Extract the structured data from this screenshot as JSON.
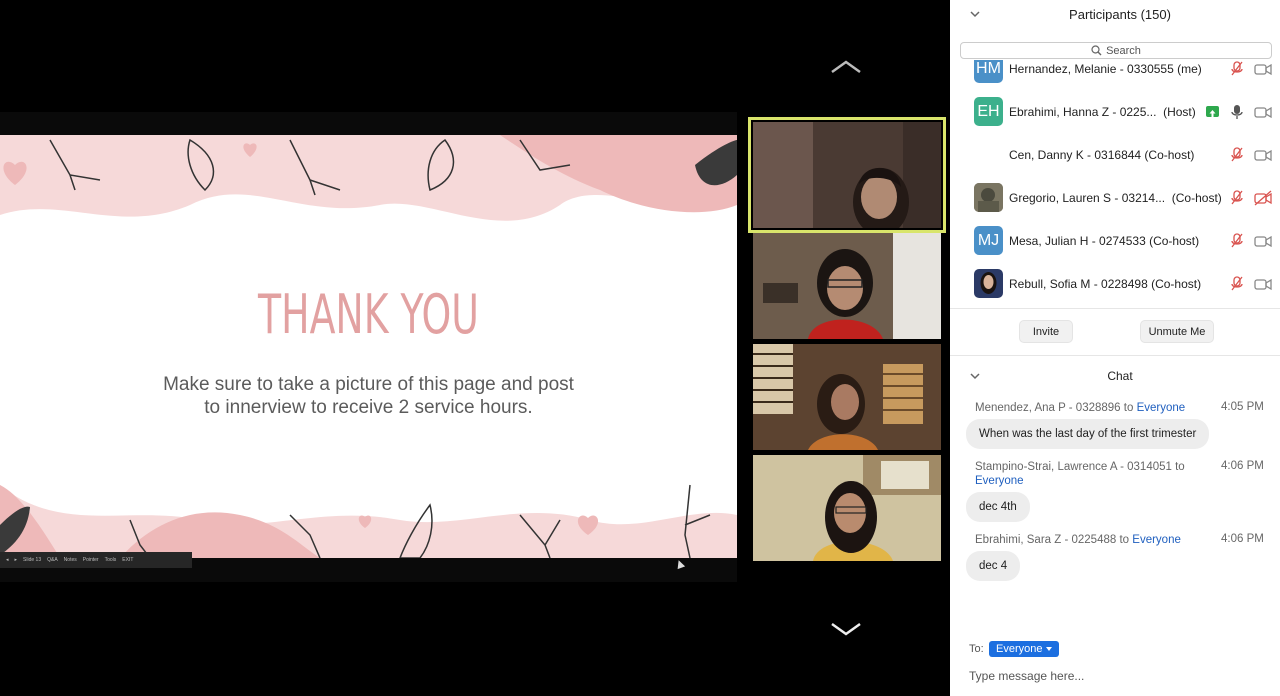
{
  "slide": {
    "title": "Thank you",
    "body_line1": "Make sure to take a picture of this page and post",
    "body_line2": "to innerview to receive 2 service hours.",
    "toolbar": [
      "Slide 13",
      "Q&A",
      "Notes",
      "Pointer",
      "Tools",
      "EXIT"
    ]
  },
  "participants": {
    "title": "Participants (150)",
    "search_placeholder": "Search",
    "rows": [
      {
        "initials": "HM",
        "name": "Hernandez, Melanie - 0330555 (me)",
        "color": "#4a90c8",
        "mic": "muted",
        "cam": "on"
      },
      {
        "initials": "EH",
        "name": "Ebrahimi, Hanna Z - 0225...",
        "role": "(Host)",
        "color": "#3cb08c",
        "mic": "on",
        "cam": "on",
        "sharing": true
      },
      {
        "initials": "",
        "name": "Cen, Danny K - 0316844 (Co-host)",
        "color": "",
        "mic": "muted",
        "cam": "on"
      },
      {
        "initials": "",
        "name": "Gregorio, Lauren S - 03214...",
        "role": "(Co-host)",
        "color": "#6e6a5a",
        "mic": "muted",
        "cam": "off",
        "photo": true
      },
      {
        "initials": "MJ",
        "name": "Mesa, Julian H - 0274533 (Co-host)",
        "color": "#4a90c8",
        "mic": "muted",
        "cam": "on"
      },
      {
        "initials": "",
        "name": "Rebull, Sofia M - 0228498 (Co-host)",
        "color": "#2b3a66",
        "mic": "muted",
        "cam": "on",
        "photo": true
      }
    ],
    "invite_label": "Invite",
    "unmute_label": "Unmute Me"
  },
  "chat": {
    "title": "Chat",
    "messages": [
      {
        "sender": "Menendez, Ana P - 0328896",
        "to": "to",
        "recipient": "Everyone",
        "time": "4:05 PM",
        "text": "When was the last day of the first trimester"
      },
      {
        "sender": "Stampino-Strai, Lawrence A - 0314051",
        "to": "to",
        "recipient": "Everyone",
        "time": "4:06 PM",
        "text": "dec 4th"
      },
      {
        "sender": "Ebrahimi, Sara Z - 0225488",
        "to": "to",
        "recipient": "Everyone",
        "time": "4:06 PM",
        "text": "dec 4"
      }
    ],
    "to_label": "To:",
    "to_value": "Everyone",
    "input_placeholder": "Type message here..."
  },
  "colors": {
    "accent": "#1c6fe0",
    "active_speaker": "#d9e56b",
    "slide_pink": "#e2a1a1"
  }
}
